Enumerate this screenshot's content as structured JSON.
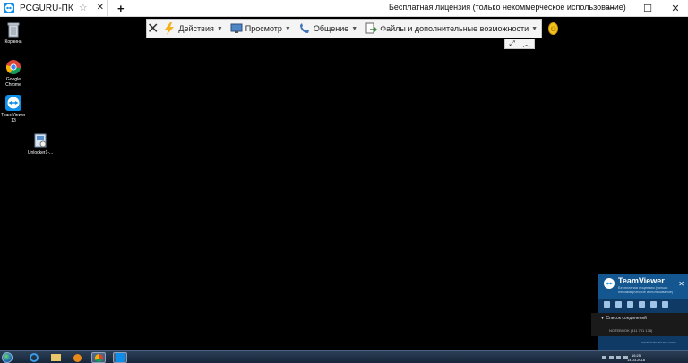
{
  "titlebar": {
    "tab_title": "PCGURU-ПК",
    "star": "☆",
    "close": "✕",
    "new_tab": "+",
    "license_text": "Бесплатная лицензия (только некоммерческое использование)",
    "minimize": "—",
    "maximize": "☐",
    "close_window": "✕"
  },
  "toolbar": {
    "close": "✕",
    "items": [
      {
        "label": "Действия",
        "icon": "lightning-icon"
      },
      {
        "label": "Просмотр",
        "icon": "monitor-icon"
      },
      {
        "label": "Общение",
        "icon": "phone-icon"
      },
      {
        "label": "Файлы и дополнительные возможности",
        "icon": "files-icon"
      }
    ],
    "caret": "▼",
    "smile": "☺"
  },
  "toolbar_mini": {
    "expand": "⤢",
    "collapse": "︿"
  },
  "desktop": {
    "icons": [
      {
        "label": "Корзина",
        "icon": "recycle-bin-icon"
      },
      {
        "label": "Google\nChrome",
        "icon": "chrome-icon"
      },
      {
        "label": "TeamViewer\n13",
        "icon": "teamviewer-icon"
      },
      {
        "label": "Unlocker1-...",
        "icon": "installer-icon"
      }
    ]
  },
  "teamviewer_panel": {
    "name": "TeamViewer",
    "subtitle": "Бесплатная лицензия (только некоммерческое использование)",
    "close": "✕",
    "list_title": "▼ Список соединений",
    "list_entry": "NOTEBOOK (411 761 178)",
    "link": "www.teamviewer.com"
  },
  "taskbar": {
    "time": "16:25",
    "date": "14.03.2018"
  },
  "colors": {
    "desktop": "#000000",
    "teamviewer_blue": "#0e8ee9",
    "panel_dark": "#0f3a66"
  }
}
